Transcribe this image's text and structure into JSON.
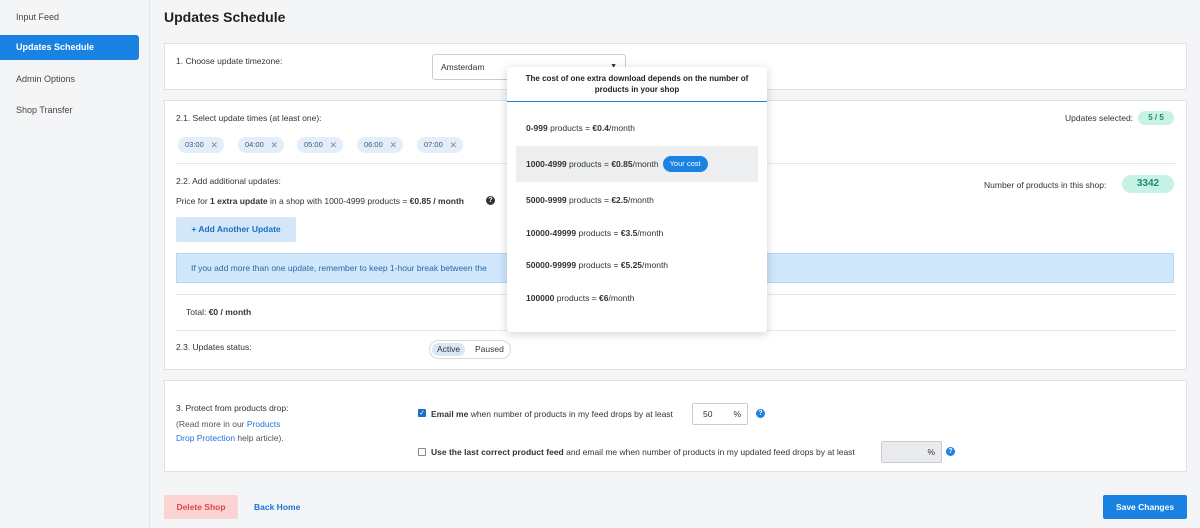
{
  "sidebar": {
    "items": [
      {
        "label": "Input Feed",
        "active": false
      },
      {
        "label": "Updates Schedule",
        "active": true
      },
      {
        "label": "Admin Options",
        "active": false
      },
      {
        "label": "Shop Transfer",
        "active": false
      }
    ]
  },
  "page": {
    "title": "Updates Schedule"
  },
  "timezone": {
    "label": "1. Choose update timezone:",
    "value": "Amsterdam"
  },
  "times": {
    "label": "2.1. Select update times (at least one):",
    "chips": [
      "03:00",
      "04:00",
      "05:00",
      "06:00",
      "07:00"
    ],
    "selected_label": "Updates selected:",
    "selected_value": "5 / 5"
  },
  "additional": {
    "label": "2.2. Add additional updates:",
    "price_prefix": "Price for ",
    "price_bold": "1 extra update",
    "price_middle": " in a shop with 1000-4999 products = ",
    "price_value": "€0.85 / month",
    "products_label": "Number of products in this shop:",
    "products_value": "3342",
    "add_button": "+ Add Another Update",
    "info_text": "If you add more than one update, remember to keep 1-hour break between the",
    "total_label": "Total:",
    "total_value": "€0 / month"
  },
  "status": {
    "label": "2.3. Updates status:",
    "options": [
      "Active",
      "Paused"
    ],
    "selected": "Active"
  },
  "protect": {
    "label": "3. Protect from products drop:",
    "help_line1": "(Read more in our ",
    "help_link1": "Products",
    "help_link2": "Drop Protection",
    "help_line2_suffix": " help article).",
    "email_bold": "Email me",
    "email_text": " when number of products in my feed drops by at least",
    "email_value": "50",
    "email_checked": true,
    "last_bold": "Use the last correct product feed",
    "last_text": " and email me when number of products in my updated feed drops by at least",
    "last_value": "",
    "last_checked": false,
    "percent_sign": "%"
  },
  "footer": {
    "delete": "Delete Shop",
    "home": "Back Home",
    "save": "Save Changes"
  },
  "popover": {
    "title": "The cost of one extra download depends on the number of products in your shop",
    "tiers": [
      {
        "range": "0-999",
        "mid": " products = ",
        "price": "€0.4",
        "unit": "/month",
        "current": false
      },
      {
        "range": "1000-4999",
        "mid": " products = ",
        "price": "€0.85",
        "unit": "/month",
        "current": true
      },
      {
        "range": "5000-9999",
        "mid": " products = ",
        "price": "€2.5",
        "unit": "/month",
        "current": false
      },
      {
        "range": "10000-49999",
        "mid": " products = ",
        "price": "€3.5",
        "unit": "/month",
        "current": false
      },
      {
        "range": "50000-99999",
        "mid": " products = ",
        "price": "€5.25",
        "unit": "/month",
        "current": false
      },
      {
        "range": "100000",
        "mid": " products = ",
        "price": "€6",
        "unit": "/month",
        "current": false
      }
    ],
    "your_cost": "Your cost"
  },
  "colors": {
    "accent": "#1a82e2",
    "success_bg": "#c9f2e6",
    "danger_bg": "#fbd3d3"
  },
  "icons": {
    "remove": "close-icon",
    "help": "question-icon",
    "caret": "caret-down-icon",
    "check": "checkmark-icon"
  }
}
